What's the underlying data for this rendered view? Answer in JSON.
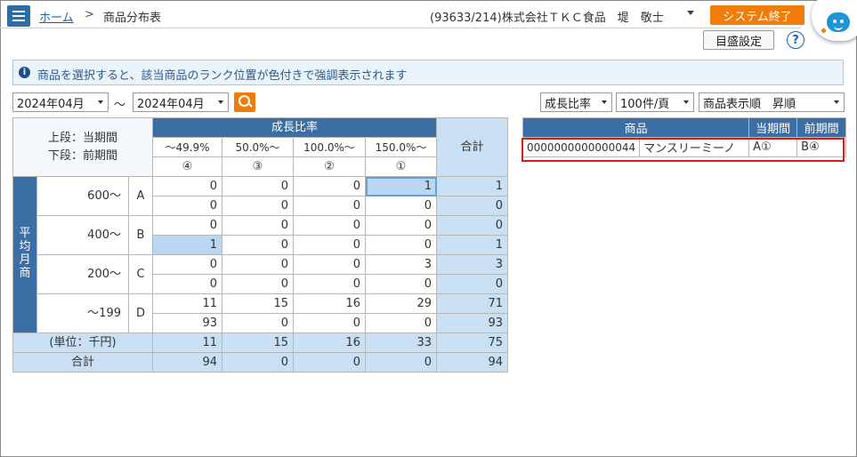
{
  "header": {
    "breadcrumb_home": "ホーム",
    "breadcrumb_sep": ">",
    "breadcrumb_current": "商品分布表",
    "user_info": "(93633/214)株式会社ＴＫＣ食品　堤　敬士",
    "end_button": "システム終了",
    "scale_button": "目盛設定",
    "help": "?"
  },
  "info": {
    "icon": "i",
    "text": "商品を選択すると、該当商品のランク位置が色付きで強調表示されます"
  },
  "controls": {
    "period_from": "2024年04月",
    "tilde": "～",
    "period_to": "2024年04月",
    "metric": "成長比率",
    "per_page": "100件/頁",
    "sort": "商品表示順　昇順"
  },
  "grid": {
    "corner_top": "上段：当期間",
    "corner_bottom": "下段：前期間",
    "group_header": "成長比率",
    "total_header": "合計",
    "columns": [
      {
        "label": "～49.9%",
        "rank": "④"
      },
      {
        "label": "50.0%～",
        "rank": "③"
      },
      {
        "label": "100.0%～",
        "rank": "②"
      },
      {
        "label": "150.0%～",
        "rank": "①"
      }
    ],
    "side_label": "平\n均\n月\n商",
    "rows": [
      {
        "range": "600～",
        "rank": "A",
        "cur": [
          "0",
          "0",
          "0",
          "1"
        ],
        "cur_total": "1",
        "prev": [
          "0",
          "0",
          "0",
          "0"
        ],
        "prev_total": "0"
      },
      {
        "range": "400～",
        "rank": "B",
        "cur": [
          "0",
          "0",
          "0",
          "0"
        ],
        "cur_total": "0",
        "prev": [
          "1",
          "0",
          "0",
          "0"
        ],
        "prev_total": "1"
      },
      {
        "range": "200～",
        "rank": "C",
        "cur": [
          "0",
          "0",
          "0",
          "3"
        ],
        "cur_total": "3",
        "prev": [
          "0",
          "0",
          "0",
          "0"
        ],
        "prev_total": "0"
      },
      {
        "range": "～199",
        "rank": "D",
        "cur": [
          "11",
          "15",
          "16",
          "29"
        ],
        "cur_total": "71",
        "prev": [
          "93",
          "0",
          "0",
          "0"
        ],
        "prev_total": "93"
      }
    ],
    "footer_unit": "(単位：千円)",
    "footer_total": "合計",
    "footer_cur": [
      "11",
      "15",
      "16",
      "33"
    ],
    "footer_cur_total": "75",
    "footer_prev": [
      "94",
      "0",
      "0",
      "0"
    ],
    "footer_prev_total": "94"
  },
  "side_table": {
    "headers": {
      "product": "商品",
      "current": "当期間",
      "previous": "前期間"
    },
    "rows": [
      {
        "code": "0000000000000044",
        "name": "マンスリーミーノ",
        "current": "A①",
        "previous": "B④"
      }
    ]
  },
  "colors": {
    "header_blue": "#3a6ea5",
    "total_blue": "#c8dff4",
    "accent_orange": "#f07d0a",
    "selection_red": "#e01818"
  }
}
